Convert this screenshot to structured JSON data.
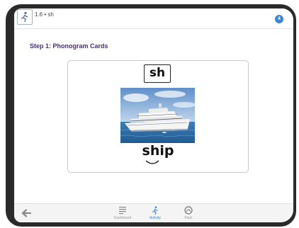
{
  "header": {
    "lesson_title": "1.6 • sh",
    "badge": "4"
  },
  "main": {
    "step_heading": "Step 1: Phonogram Cards",
    "card": {
      "phonogram": "sh",
      "image_name": "cruise-ship-photo",
      "word": "ship"
    }
  },
  "footer": {
    "nav": [
      {
        "label": "Dashboard",
        "icon": "dashboard-icon"
      },
      {
        "label": "Activity",
        "icon": "activity-icon"
      },
      {
        "label": "Pack",
        "icon": "pack-icon"
      }
    ]
  },
  "colors": {
    "heading": "#4a2a82",
    "accent": "#3b86d8",
    "device_bezel": "#2a2a2a"
  }
}
